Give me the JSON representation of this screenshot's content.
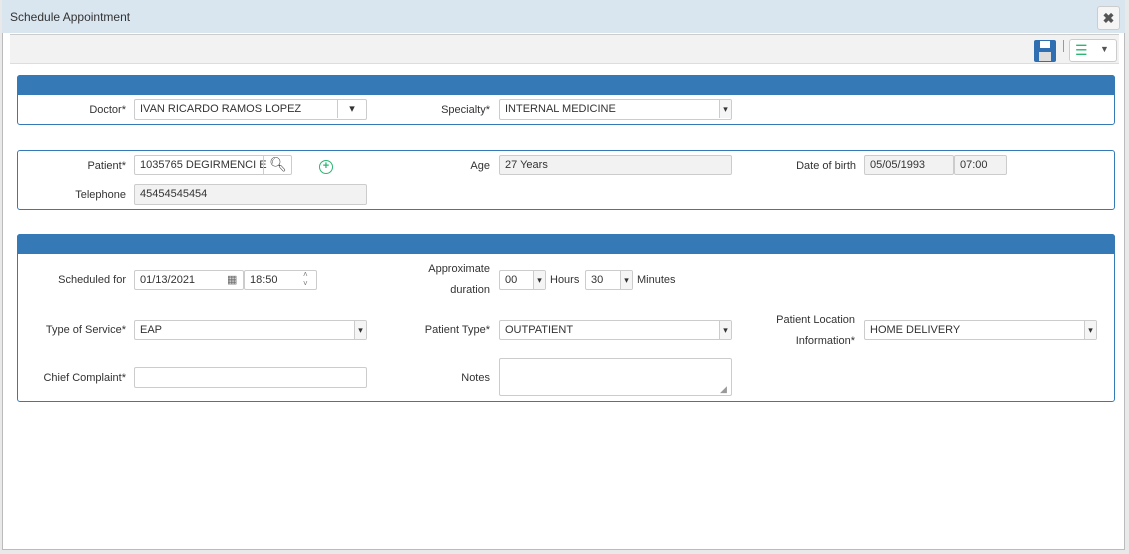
{
  "window": {
    "title": "Schedule Appointment",
    "close_icon": "close-icon"
  },
  "toolbar": {
    "save_icon": "floppy-disk-icon",
    "list_icon": "list-icon",
    "accent": "#2bb673"
  },
  "colors": {
    "section_header": "#357ab7",
    "title_bar": "#d9e5ef"
  },
  "doctor_section": {
    "doctor_label": "Doctor*",
    "doctor_value": "IVAN RICARDO RAMOS LOPEZ",
    "specialty_label": "Specialty*",
    "specialty_value": "INTERNAL MEDICINE"
  },
  "patient_section": {
    "patient_label": "Patient*",
    "patient_value": "1035765 DEGIRMENCI E",
    "age_label": "Age",
    "age_value": "27 Years",
    "dob_label": "Date of birth",
    "dob_value": "05/05/1993",
    "dob_time": "07:00",
    "telephone_label": "Telephone",
    "telephone_value": "45454545454"
  },
  "appointment_section": {
    "scheduled_label": "Scheduled for",
    "scheduled_date": "01/13/2021",
    "scheduled_time": "18:50",
    "duration_label_1": "Approximate",
    "duration_label_2": "duration",
    "hours_value": "00",
    "hours_label": "Hours",
    "minutes_value": "30",
    "minutes_label": "Minutes",
    "service_label": "Type of Service*",
    "service_value": "EAP",
    "patient_type_label": "Patient Type*",
    "patient_type_value": "OUTPATIENT",
    "location_label_1": "Patient Location",
    "location_label_2": "Information*",
    "location_value": "HOME DELIVERY",
    "complaint_label": "Chief Complaint*",
    "complaint_value": "",
    "notes_label": "Notes",
    "notes_value": ""
  }
}
